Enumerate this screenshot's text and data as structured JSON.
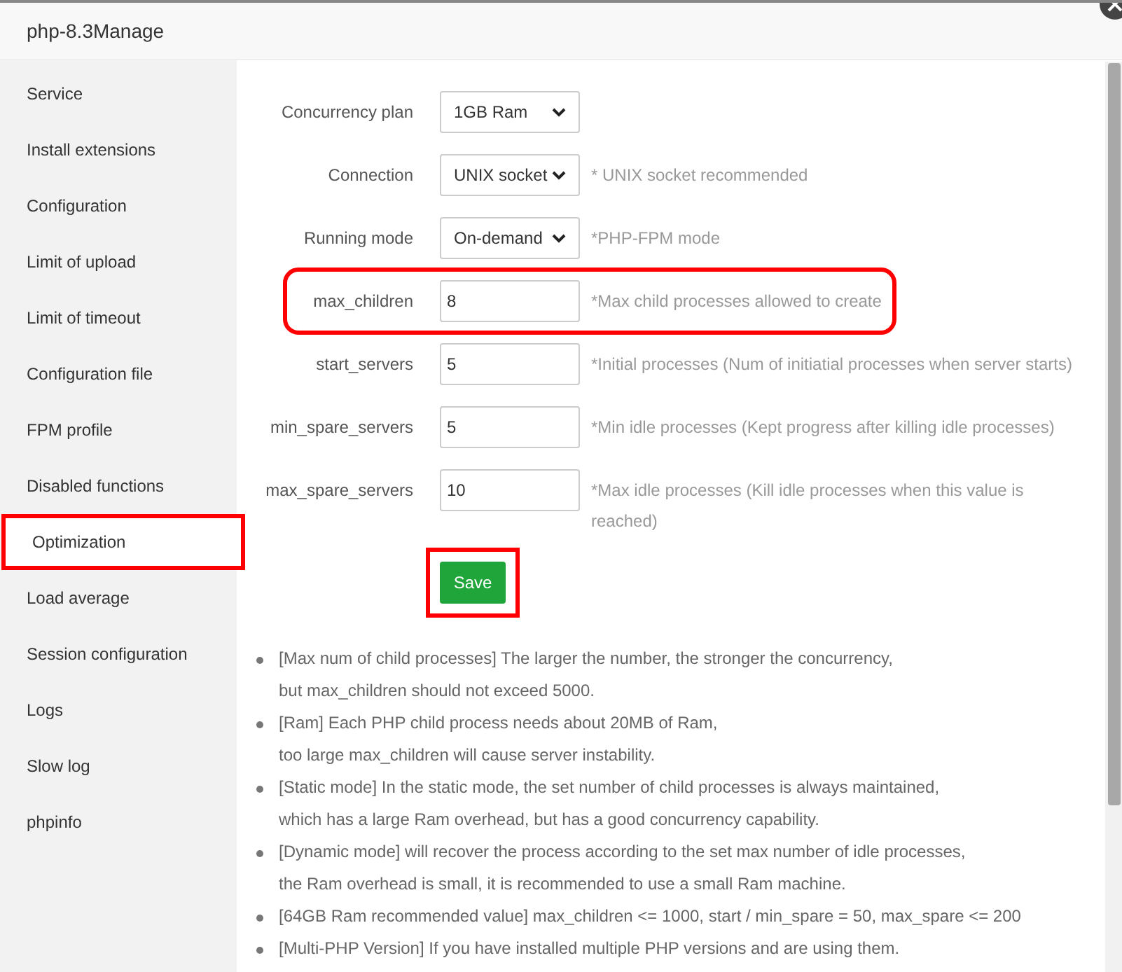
{
  "window": {
    "title": "php-8.3Manage"
  },
  "sidebar": {
    "items": [
      {
        "label": "Service",
        "selected": false,
        "highlighted": false
      },
      {
        "label": "Install extensions",
        "selected": false,
        "highlighted": false
      },
      {
        "label": "Configuration",
        "selected": false,
        "highlighted": false
      },
      {
        "label": "Limit of upload",
        "selected": false,
        "highlighted": false
      },
      {
        "label": "Limit of timeout",
        "selected": false,
        "highlighted": false
      },
      {
        "label": "Configuration file",
        "selected": false,
        "highlighted": false
      },
      {
        "label": "FPM profile",
        "selected": false,
        "highlighted": false
      },
      {
        "label": "Disabled functions",
        "selected": false,
        "highlighted": false
      },
      {
        "label": "Optimization",
        "selected": true,
        "highlighted": true
      },
      {
        "label": "Load average",
        "selected": false,
        "highlighted": false
      },
      {
        "label": "Session configuration",
        "selected": false,
        "highlighted": false
      },
      {
        "label": "Logs",
        "selected": false,
        "highlighted": false
      },
      {
        "label": "Slow log",
        "selected": false,
        "highlighted": false
      },
      {
        "label": "phpinfo",
        "selected": false,
        "highlighted": false
      }
    ]
  },
  "form": {
    "fields": [
      {
        "kind": "select",
        "label": "Concurrency plan",
        "value": "1GB Ram",
        "highlighted": false
      },
      {
        "kind": "select",
        "label": "Connection",
        "value": "UNIX socket",
        "hint": "* UNIX socket recommended",
        "highlighted": false
      },
      {
        "kind": "select",
        "label": "Running mode",
        "value": "On-demand",
        "hint": "*PHP-FPM mode",
        "highlighted": false
      },
      {
        "kind": "input",
        "label": "max_children",
        "value": "8",
        "hint": "*Max child processes allowed to create",
        "highlighted": true
      },
      {
        "kind": "input",
        "label": "start_servers",
        "value": "5",
        "hint": "*Initial processes (Num of initiatial processes when server starts)",
        "highlighted": false
      },
      {
        "kind": "input",
        "label": "min_spare_servers",
        "value": "5",
        "hint": "*Min idle processes (Kept progress after killing idle processes)",
        "highlighted": false
      },
      {
        "kind": "input",
        "label": "max_spare_servers",
        "value": "10",
        "hint": "*Max idle processes (Kill idle processes when this value is reached)",
        "highlighted": false
      }
    ],
    "save_button": {
      "label": "Save",
      "highlighted": true
    }
  },
  "notes": [
    {
      "lines": [
        "[Max num of child processes] The larger the number, the stronger the concurrency,",
        "but max_children should not exceed 5000."
      ]
    },
    {
      "lines": [
        "[Ram] Each PHP child process needs about 20MB of Ram,",
        "too large max_children will cause server instability."
      ]
    },
    {
      "lines": [
        "[Static mode] In the static mode, the set number of child processes is always maintained,",
        "which has a large Ram overhead, but has a good concurrency capability."
      ]
    },
    {
      "lines": [
        "[Dynamic mode] will recover the process according to the set max number of idle processes,",
        "the Ram overhead is small, it is recommended to use a small Ram machine."
      ]
    },
    {
      "lines": [
        "[64GB Ram recommended value] max_children <= 1000, start / min_spare = 50, max_spare <= 200"
      ]
    },
    {
      "lines": [
        "[Multi-PHP Version] If you have installed multiple PHP versions and are using them."
      ]
    }
  ]
}
